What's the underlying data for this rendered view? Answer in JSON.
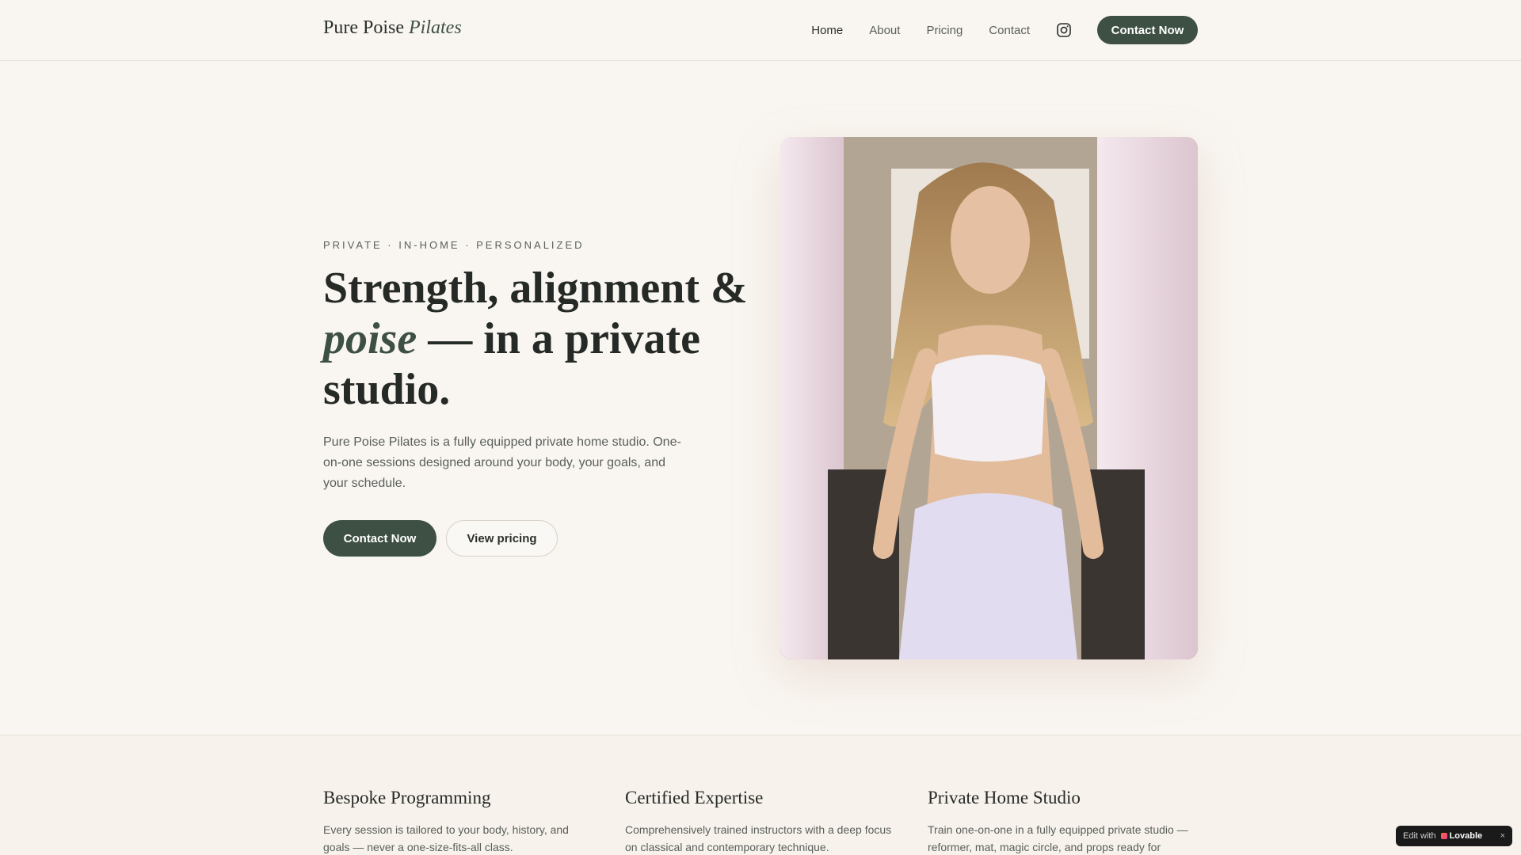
{
  "header": {
    "logo_main": "Pure Poise",
    "logo_accent": "Pilates",
    "nav": [
      "Home",
      "About",
      "Pricing",
      "Contact"
    ],
    "instagram_icon": "instagram-icon",
    "cta": "Contact Now"
  },
  "hero": {
    "eyebrow": "PRIVATE · IN-HOME · PERSONALIZED",
    "headline_part1": "Strength, alignment &",
    "headline_italic": "poise",
    "headline_part2": " — in a private studio.",
    "intro": "Pure Poise Pilates is a fully equipped private home studio. One-on-one sessions designed around your body, your goals, and your schedule.",
    "primary_cta": "Contact Now",
    "secondary_cta": "View pricing"
  },
  "features": [
    {
      "title": "Bespoke Programming",
      "text": "Every session is tailored to your body, history, and goals — never a one-size-fits-all class."
    },
    {
      "title": "Certified Expertise",
      "text": "Comprehensively trained instructors with a deep focus on classical and contemporary technique."
    },
    {
      "title": "Private Home Studio",
      "text": "Train one-on-one in a fully equipped private studio — reformer, mat, magic circle, and props ready for"
    }
  ],
  "badge": {
    "label": "Edit with",
    "brand": "Lovable",
    "close": "×"
  },
  "colors": {
    "accent": "#3d5043",
    "background": "#f9f6f1",
    "text": "#2b2f2c"
  }
}
